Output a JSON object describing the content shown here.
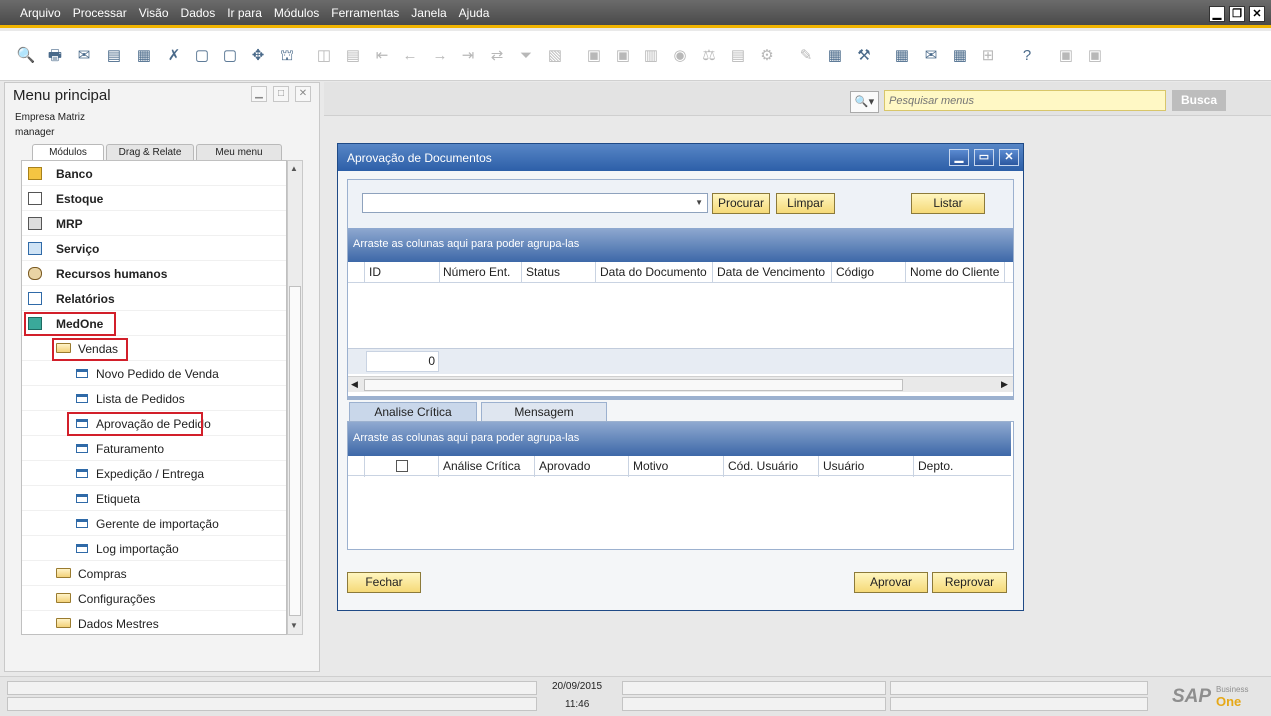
{
  "menubar": {
    "items": [
      "Arquivo",
      "Processar",
      "Visão",
      "Dados",
      "Ir para",
      "Módulos",
      "Ferramentas",
      "Janela",
      "Ajuda"
    ]
  },
  "window_controls": {
    "minimize": "▁",
    "restore": "❐",
    "close": "✕"
  },
  "left_panel": {
    "title": "Menu principal",
    "company": "Empresa Matriz",
    "user": "manager",
    "tabs": [
      "Módulos",
      "Drag & Relate",
      "Meu menu"
    ],
    "modules": [
      "Banco",
      "Estoque",
      "MRP",
      "Serviço",
      "Recursos humanos",
      "Relatórios",
      "MedOne"
    ],
    "vendas_folder": "Vendas",
    "vendas_items": [
      "Novo Pedido de Venda",
      "Lista de Pedidos",
      "Aprovação de Pedido",
      "Faturamento",
      "Expedição / Entrega",
      "Etiqueta",
      "Gerente de importação",
      "Log importação"
    ],
    "other_folders": [
      "Compras",
      "Configurações",
      "Dados Mestres"
    ]
  },
  "search": {
    "placeholder": "Pesquisar menus",
    "button": "Busca"
  },
  "dialog": {
    "title": "Aprovação de Documentos",
    "buttons": {
      "procurar": "Procurar",
      "limpar": "Limpar",
      "listar": "Listar",
      "fechar": "Fechar",
      "aprovar": "Aprovar",
      "reprovar": "Reprovar"
    },
    "group_hint": "Arraste as colunas aqui para poder agrupa-las",
    "upper_columns": [
      "ID",
      "Número Ent.",
      "Status",
      "Data do Documento",
      "Data de Vencimento",
      "Código",
      "Nome do Cliente"
    ],
    "count_value": "0",
    "lower_tabs": [
      "Analise Crítica",
      "Mensagem"
    ],
    "lower_columns": [
      "Análise Crítica",
      "Aprovado",
      "Motivo",
      "Cód. Usuário",
      "Usuário",
      "Depto."
    ]
  },
  "status_bar": {
    "date": "20/09/2015",
    "time": "11:46"
  },
  "brand": {
    "sap": "SAP",
    "business": "Business",
    "one": "One"
  },
  "colors": {
    "accent": "#f0b400",
    "highlight": "#d21f2a",
    "dialog_title": "#2d5fa8",
    "button_yellow": "#f5d978"
  }
}
